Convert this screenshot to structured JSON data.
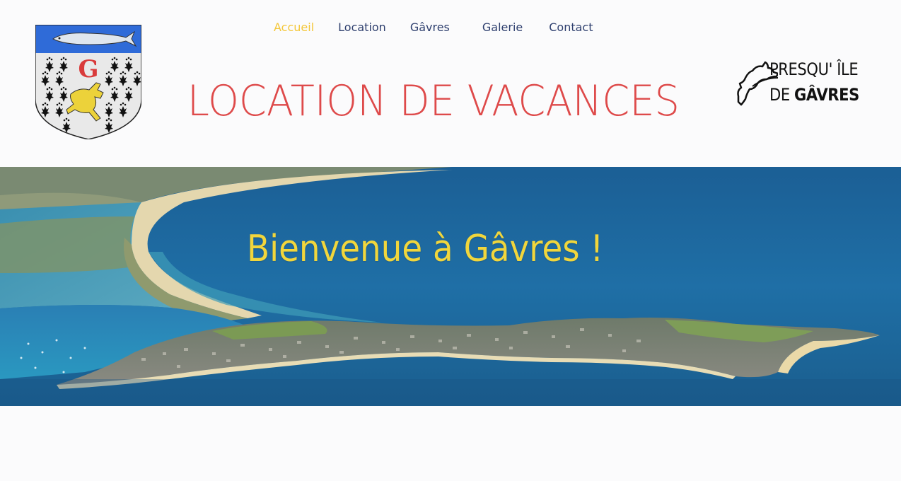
{
  "nav": {
    "items": [
      {
        "label": "Accueil",
        "active": true
      },
      {
        "label": "Location",
        "active": false
      },
      {
        "label": "Gâvres",
        "active": false
      },
      {
        "label": "Galerie",
        "active": false
      },
      {
        "label": "Contact",
        "active": false
      }
    ]
  },
  "header": {
    "title": "LOCATION DE VACANCES",
    "logo_line1": "PRESQU' ÎLE",
    "logo_line2_prefix": "DE ",
    "logo_line2_bold": "GÂVRES",
    "coat_of_arms_letter": "G"
  },
  "hero": {
    "title": "Bienvenue à Gâvres !"
  },
  "colors": {
    "nav_active": "#f4c739",
    "nav_default": "#2e3f6e",
    "title_red": "#de4a4a",
    "hero_title_yellow": "#f1d63c",
    "background": "#fbfbfc"
  },
  "icons": {
    "coat_of_arms": "coat-of-arms-icon",
    "island_outline": "island-outline-icon"
  }
}
